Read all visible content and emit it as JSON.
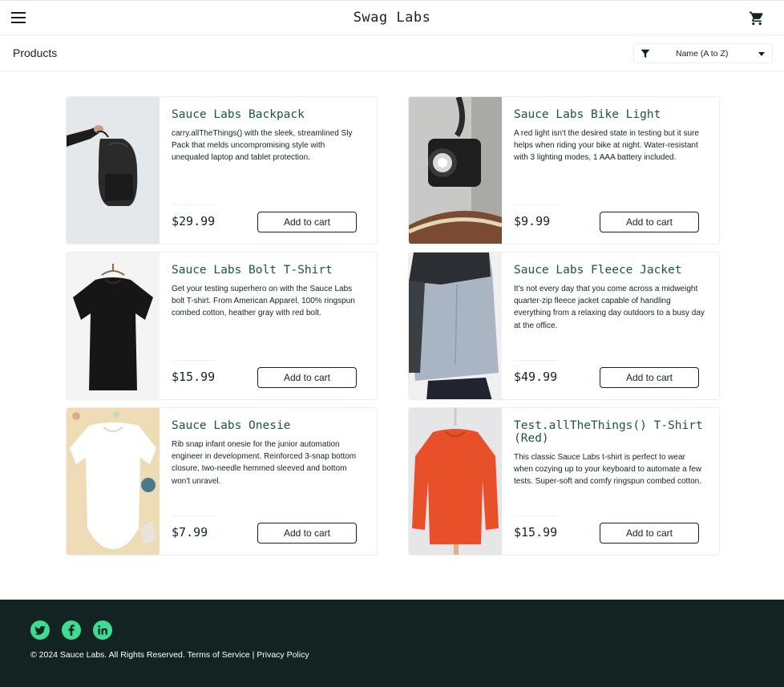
{
  "header": {
    "app_title": "Swag Labs",
    "menu_icon": "hamburger-menu-icon",
    "cart_icon": "shopping-cart-icon"
  },
  "subheader": {
    "page_title": "Products",
    "sort_selected": "Name (A to Z)",
    "sort_icon": "filter-icon"
  },
  "products": [
    {
      "name": "Sauce Labs Backpack",
      "description": "carry.allTheThings() with the sleek, streamlined Sly Pack that melds uncompromising style with unequaled laptop and tablet protection.",
      "price": "$29.99",
      "button": "Add to cart"
    },
    {
      "name": "Sauce Labs Bike Light",
      "description": "A red light isn't the desired state in testing but it sure helps when riding your bike at night. Water-resistant with 3 lighting modes, 1 AAA battery included.",
      "price": "$9.99",
      "button": "Add to cart"
    },
    {
      "name": "Sauce Labs Bolt T-Shirt",
      "description": "Get your testing superhero on with the Sauce Labs bolt T-shirt. From American Apparel, 100% ringspun combed cotton, heather gray with red bolt.",
      "price": "$15.99",
      "button": "Add to cart"
    },
    {
      "name": "Sauce Labs Fleece Jacket",
      "description": "It's not every day that you come across a midweight quarter-zip fleece jacket capable of handling everything from a relaxing day outdoors to a busy day at the office.",
      "price": "$49.99",
      "button": "Add to cart"
    },
    {
      "name": "Sauce Labs Onesie",
      "description": "Rib snap infant onesie for the junior automation engineer in development. Reinforced 3-snap bottom closure, two-needle hemmed sleeved and bottom won't unravel.",
      "price": "$7.99",
      "button": "Add to cart"
    },
    {
      "name": "Test.allTheThings() T-Shirt (Red)",
      "description": "This classic Sauce Labs t-shirt is perfect to wear when cozying up to your keyboard to automate a few tests. Super-soft and comfy ringspun combed cotton.",
      "price": "$15.99",
      "button": "Add to cart"
    }
  ],
  "footer": {
    "social": [
      "twitter-icon",
      "facebook-icon",
      "linkedin-icon"
    ],
    "copyright": "© 2024 Sauce Labs. All Rights Reserved. Terms of Service | Privacy Policy"
  },
  "colors": {
    "accent": "#3ddc91",
    "footer_bg": "#132322",
    "product_name": "#18583a"
  }
}
